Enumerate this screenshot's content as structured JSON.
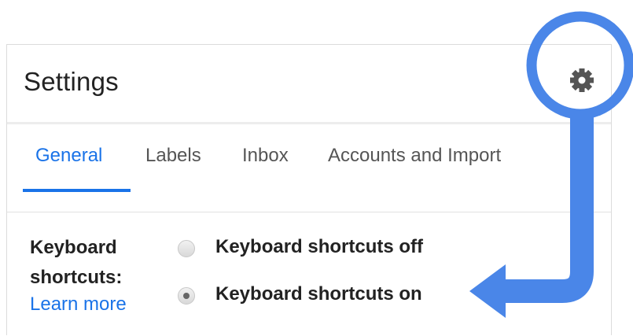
{
  "header": {
    "title": "Settings"
  },
  "tabs": [
    {
      "label": "General",
      "active": true
    },
    {
      "label": "Labels",
      "active": false
    },
    {
      "label": "Inbox",
      "active": false
    },
    {
      "label": "Accounts and Import",
      "active": false
    }
  ],
  "keyboard_setting": {
    "label": "Keyboard shortcuts:",
    "learn_more": "Learn more",
    "options": [
      {
        "label": "Keyboard shortcuts off",
        "selected": false
      },
      {
        "label": "Keyboard shortcuts on",
        "selected": true
      }
    ]
  },
  "icons": {
    "settings": "gear-icon"
  },
  "colors": {
    "accent": "#1a73e8",
    "annotation": "#4a86e8"
  }
}
